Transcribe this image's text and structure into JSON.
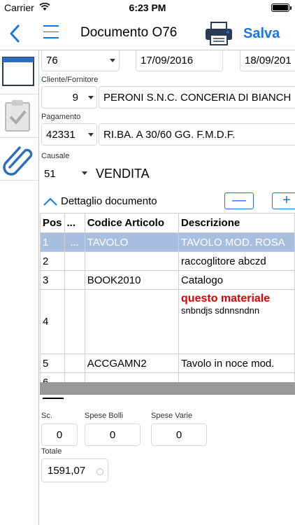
{
  "status_bar": {
    "carrier": "Carrier",
    "time": "6:23 PM"
  },
  "nav": {
    "title": "Documento O76",
    "save_label": "Salva"
  },
  "header_row": {
    "series": "76",
    "date1": "17/09/2016",
    "date2": "18/09/201"
  },
  "cliente": {
    "label": "Cliente/Fornitore",
    "code": "9",
    "name": "PERONI S.N.C. CONCERIA DI BIANCH"
  },
  "pagamento": {
    "label": "Pagamento",
    "code": "42331",
    "description": "RI.BA. A 30/60 GG. F.M.D.F."
  },
  "causale": {
    "label": "Causale",
    "code": "51",
    "description": "VENDITA"
  },
  "detail": {
    "toggle_label": "Dettaglio documento",
    "minus_label": "—",
    "plus_label": "+"
  },
  "table": {
    "headers": [
      "Pos",
      "...",
      "Codice Articolo",
      "Descrizione"
    ],
    "rows": [
      {
        "pos": "1",
        "dots": "...",
        "code": "TAVOLO",
        "desc": "TAVOLO MOD. ROSA"
      },
      {
        "pos": "2",
        "dots": "",
        "code": "",
        "desc": "raccoglitore abczd"
      },
      {
        "pos": "3",
        "dots": "",
        "code": "BOOK2010",
        "desc": "Catalogo"
      },
      {
        "pos": "4",
        "dots": "",
        "code": "",
        "desc_line1": "questo materiale",
        "desc_line2": "snbndjs sdnnsndnn"
      },
      {
        "pos": "5",
        "dots": "",
        "code": "ACCGAMN2",
        "desc": "Tavolo in noce mod."
      },
      {
        "pos": "6",
        "dots": "",
        "code": "",
        "desc": ""
      }
    ]
  },
  "footer": {
    "sconto_label": "Sc.",
    "sconto_value": "0",
    "bolli_label": "Spese Bolli",
    "bolli_value": "0",
    "varie_label": "Spese Varie",
    "varie_value": "0",
    "totale_label": "Totale",
    "totale_value": "1591,07"
  },
  "colors": {
    "accent": "#1a73e8",
    "selection": "#a9bfdf",
    "warning_text": "#e00000"
  },
  "icons": [
    "back-chevron-icon",
    "hamburger-menu-icon",
    "printer-icon",
    "document-window-icon",
    "clipboard-check-icon",
    "paperclip-icon",
    "chevron-up-icon",
    "refresh-icon"
  ]
}
